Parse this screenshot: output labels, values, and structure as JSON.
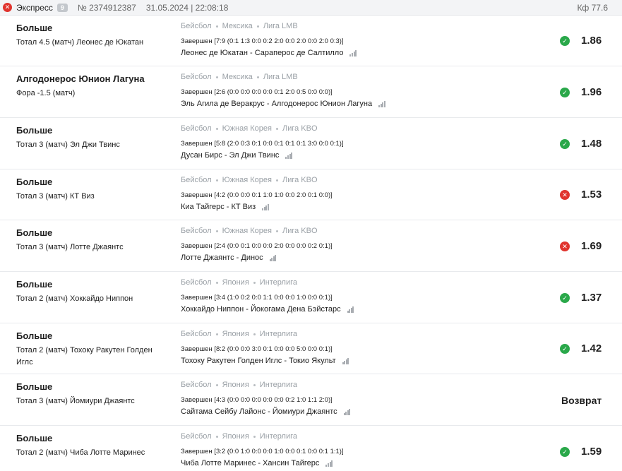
{
  "header": {
    "type": "Экспресс",
    "count": "9",
    "number": "№ 2374912387",
    "datetime": "31.05.2024 | 22:08:18",
    "coef": "Кф 77.6"
  },
  "bets": [
    {
      "main": "Больше",
      "market": "Тотал 4.5 (матч) Леонес де Юкатан",
      "sport": "Бейсбол",
      "country": "Мексика",
      "league": "Лига LMB",
      "status": "Завершен [7:9 (0:1 1:3 0:0 0:2 2:0 0:0 2:0 0:0 2:0 0:3)]",
      "teams": "Леонес де Юкатан - Сараперос де Салтилло",
      "result": "win",
      "result_icon": "check-icon",
      "odds": "1.86"
    },
    {
      "main": "Алгодонерос Юнион Лагуна",
      "market": "Фора -1.5 (матч)",
      "sport": "Бейсбол",
      "country": "Мексика",
      "league": "Лига LMB",
      "status": "Завершен [2:6 (0:0 0:0 0:0 0:0 0:1 2:0 0:5 0:0 0:0)]",
      "teams": "Эль Агила де Веракрус - Алгодонерос Юнион Лагуна",
      "result": "win",
      "result_icon": "check-icon",
      "odds": "1.96"
    },
    {
      "main": "Больше",
      "market": "Тотал 3 (матч) Эл Джи Твинс",
      "sport": "Бейсбол",
      "country": "Южная Корея",
      "league": "Лига KBO",
      "status": "Завершен [5:8 (2:0 0:3 0:1 0:0 0:1 0:1 0:1 3:0 0:0 0:1)]",
      "teams": "Дусан Бирс - Эл Джи Твинс",
      "result": "win",
      "result_icon": "check-icon",
      "odds": "1.48"
    },
    {
      "main": "Больше",
      "market": "Тотал 3 (матч) КТ Виз",
      "sport": "Бейсбол",
      "country": "Южная Корея",
      "league": "Лига KBO",
      "status": "Завершен [4:2 (0:0 0:0 0:1 1:0 1:0 0:0 2:0 0:1 0:0)]",
      "teams": "Киа Тайгерс - КТ Виз",
      "result": "loss",
      "result_icon": "cross-icon",
      "odds": "1.53"
    },
    {
      "main": "Больше",
      "market": "Тотал 3 (матч) Лотте Джаянтс",
      "sport": "Бейсбол",
      "country": "Южная Корея",
      "league": "Лига KBO",
      "status": "Завершен [2:4 (0:0 0:1 0:0 0:0 2:0 0:0 0:0 0:2 0:1)]",
      "teams": "Лотте Джаянтс - Динос",
      "result": "loss",
      "result_icon": "cross-icon",
      "odds": "1.69"
    },
    {
      "main": "Больше",
      "market": "Тотал 2 (матч) Хоккайдо Ниппон",
      "sport": "Бейсбол",
      "country": "Япония",
      "league": "Интерлига",
      "status": "Завершен [3:4 (1:0 0:2 0:0 1:1 0:0 0:0 1:0 0:0 0:1)]",
      "teams": "Хоккайдо Ниппон - Йокогама Дена Бэйстарс",
      "result": "win",
      "result_icon": "check-icon",
      "odds": "1.37"
    },
    {
      "main": "Больше",
      "market": "Тотал 2 (матч) Тохоку Ракутен Голден Иглс",
      "sport": "Бейсбол",
      "country": "Япония",
      "league": "Интерлига",
      "status": "Завершен [8:2 (0:0 0:0 3:0 0:1 0:0 0:0 5:0 0:0 0:1)]",
      "teams": "Тохоку Ракутен Голден Иглс - Токио Якульт",
      "result": "win",
      "result_icon": "check-icon",
      "odds": "1.42"
    },
    {
      "main": "Больше",
      "market": "Тотал 3 (матч) Йомиури Джаянтс",
      "sport": "Бейсбол",
      "country": "Япония",
      "league": "Интерлига",
      "status": "Завершен [4:3 (0:0 0:0 0:0 0:0 0:0 0:2 1:0 1:1 2:0)]",
      "teams": "Сайтама Сейбу Лайонс - Йомиури Джаянтс",
      "result": "refund",
      "result_icon": "",
      "odds": "Возврат"
    },
    {
      "main": "Больше",
      "market": "Тотал 2 (матч) Чиба Лотте Маринес",
      "sport": "Бейсбол",
      "country": "Япония",
      "league": "Интерлига",
      "status": "Завершен [3:2 (0:0 1:0 0:0 0:0 1:0 0:0 0:1 0:0 0:1 1:1)]",
      "teams": "Чиба Лотте Маринес - Хансин Тайгерс",
      "result": "win",
      "result_icon": "check-icon",
      "odds": "1.59"
    }
  ],
  "colors": {
    "win": "#2aa84a",
    "loss": "#e0342e"
  }
}
